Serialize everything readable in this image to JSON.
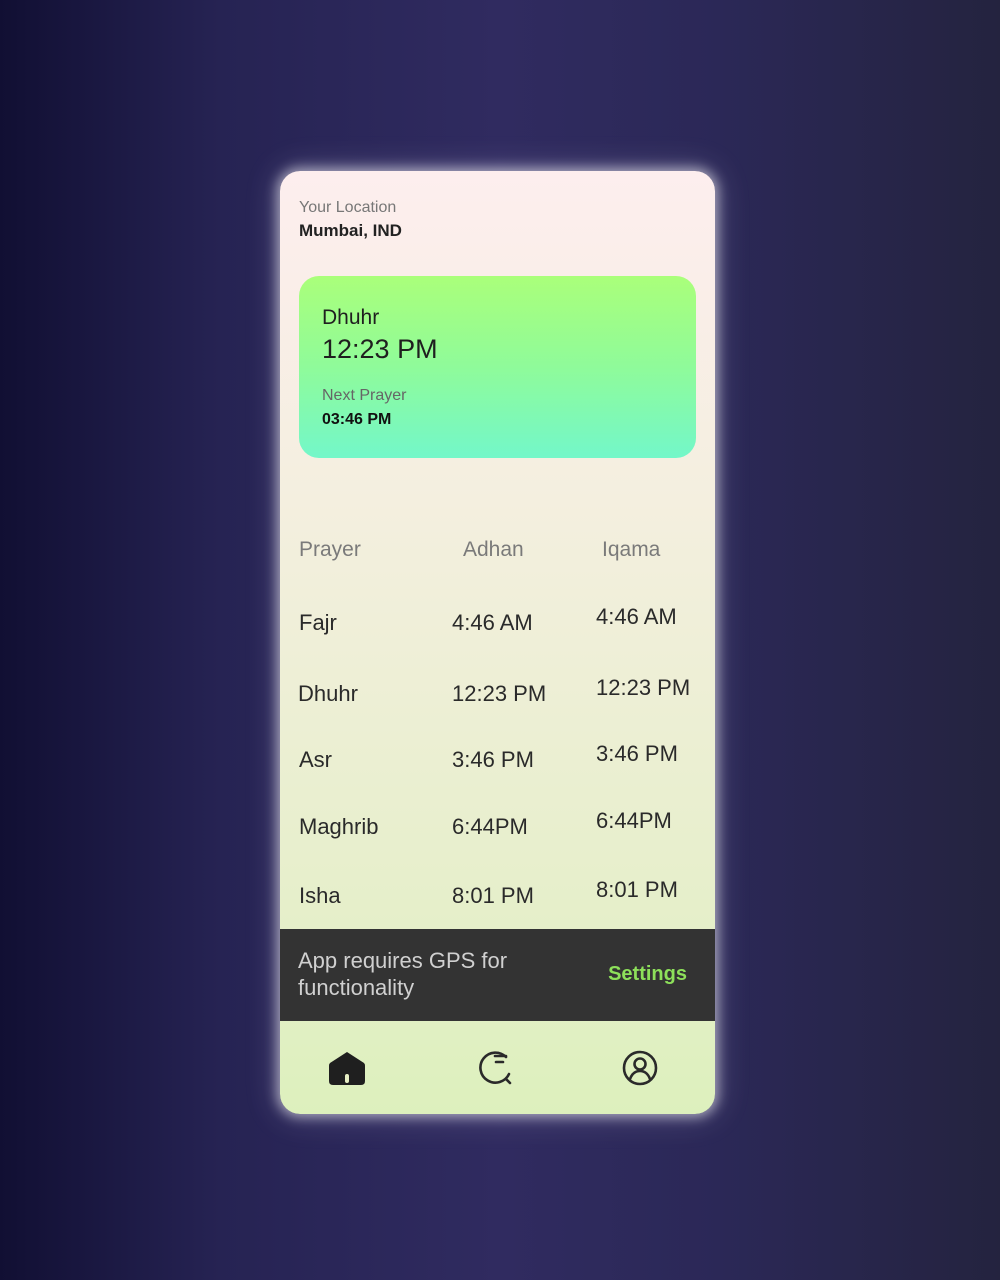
{
  "location": {
    "label": "Your Location",
    "value": "Mumbai, IND"
  },
  "current_prayer": {
    "name": "Dhuhr",
    "time": "12:23 PM",
    "next_label": "Next Prayer",
    "next_time": "03:46 PM"
  },
  "table": {
    "headers": [
      "Prayer",
      "Adhan",
      "Iqama"
    ],
    "rows": [
      {
        "prayer": "Fajr",
        "adhan": "4:46 AM",
        "iqama": "4:46 AM"
      },
      {
        "prayer": "Dhuhr",
        "adhan": "12:23 PM",
        "iqama": "12:23 PM"
      },
      {
        "prayer": "Asr",
        "adhan": "3:46 PM",
        "iqama": "3:46 PM"
      },
      {
        "prayer": "Maghrib",
        "adhan": "6:44PM",
        "iqama": "6:44PM"
      },
      {
        "prayer": "Isha",
        "adhan": "8:01 PM",
        "iqama": "8:01 PM"
      }
    ]
  },
  "snackbar": {
    "message": "App requires GPS for functionality",
    "action": "Settings"
  },
  "nav": {
    "items": [
      {
        "icon": "home-icon",
        "active": true
      },
      {
        "icon": "timer-search-icon",
        "active": false
      },
      {
        "icon": "profile-icon",
        "active": false
      }
    ]
  },
  "colors": {
    "background": "#2b2857",
    "card_gradient_top": "#aaff7a",
    "card_gradient_bottom": "#73f7c9",
    "snackbar_bg": "#333333",
    "snackbar_action": "#8de05a"
  }
}
